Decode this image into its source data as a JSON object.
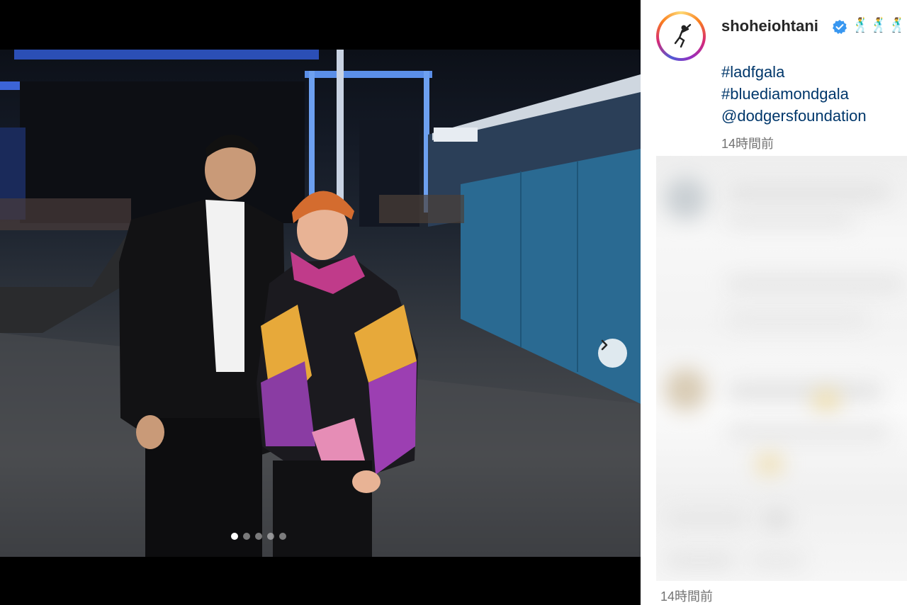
{
  "post": {
    "username": "shoheiohtani",
    "verified_icon": "verified-badge-icon",
    "emojis": "🕺🕺🕺",
    "caption_lines": [
      "#ladfgala",
      "#bluediamondgala",
      "@dodgersfoundation"
    ],
    "time_ago": "14時間前"
  },
  "carousel": {
    "total_slides": 5,
    "current_slide": 1,
    "next_icon": "chevron-right-icon"
  },
  "comments": {
    "blurred": true,
    "time_ago": "14時間前"
  },
  "colors": {
    "link": "#00376b",
    "username": "#262626",
    "muted": "#737373",
    "verified": "#3897f0"
  }
}
